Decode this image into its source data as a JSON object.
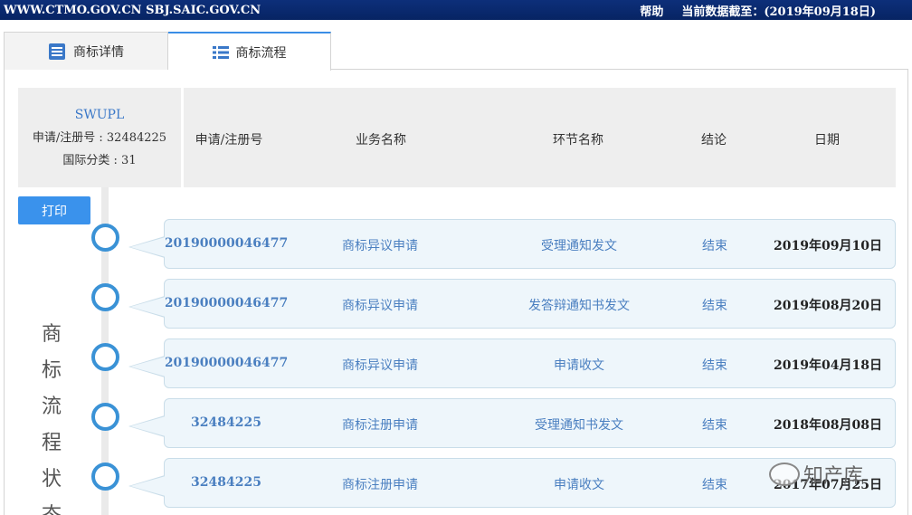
{
  "topbar": {
    "domains": "WWW.CTMO.GOV.CN SBJ.SAIC.GOV.CN",
    "help": "帮助",
    "data_date": "当前数据截至：(2019年09月18日)"
  },
  "tabs": [
    {
      "label": "商标详情",
      "icon": "document-icon"
    },
    {
      "label": "商标流程",
      "icon": "list-icon"
    }
  ],
  "info": {
    "trademark_name": "SWUPL",
    "reg_no": "申请/注册号 : 32484225",
    "class": "国际分类 : 31"
  },
  "columns": [
    "申请/注册号",
    "业务名称",
    "环节名称",
    "结论",
    "日期"
  ],
  "print_label": "打印",
  "side_title": [
    "商",
    "标",
    "流",
    "程",
    "状",
    "态"
  ],
  "rows": [
    {
      "no": "20190000046477",
      "business": "商标异议申请",
      "step": "受理通知发文",
      "result": "结束",
      "date": "2019年09月10日"
    },
    {
      "no": "20190000046477",
      "business": "商标异议申请",
      "step": "发答辩通知书发文",
      "result": "结束",
      "date": "2019年08月20日"
    },
    {
      "no": "20190000046477",
      "business": "商标异议申请",
      "step": "申请收文",
      "result": "结束",
      "date": "2019年04月18日"
    },
    {
      "no": "32484225",
      "business": "商标注册申请",
      "step": "受理通知书发文",
      "result": "结束",
      "date": "2018年08月08日"
    },
    {
      "no": "32484225",
      "business": "商标注册申请",
      "step": "申请收文",
      "result": "结束",
      "date": "2017年07月25日"
    }
  ],
  "watermark": "知产库",
  "colors": {
    "topbar": "#0d2f7a",
    "accent": "#3a92ec",
    "link": "#4a7fc0",
    "row_bg": "#eef6fb"
  }
}
